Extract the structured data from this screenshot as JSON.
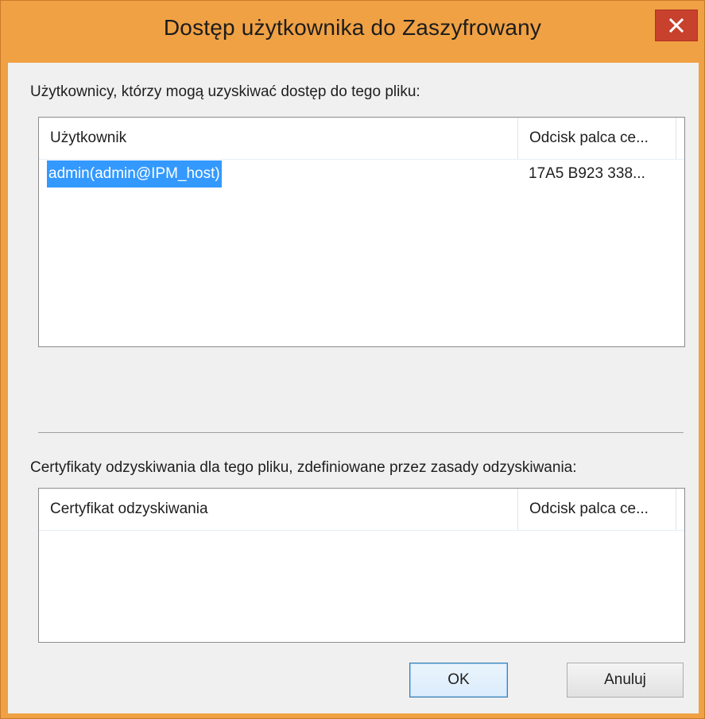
{
  "window": {
    "title": "Dostęp użytkownika do Zaszyfrowany",
    "close_glyph": "×"
  },
  "users_section": {
    "label": "Użytkownicy, którzy mogą uzyskiwać dostęp do tego pliku:",
    "columns": [
      "Użytkownik",
      "Odcisk palca ce..."
    ],
    "rows": [
      {
        "user": "admin(admin@IPM_host)",
        "thumbprint": "17A5 B923 338...",
        "selected": true
      }
    ]
  },
  "recovery_section": {
    "label": "Certyfikaty odzyskiwania dla tego pliku, zdefiniowane przez zasady odzyskiwania:",
    "columns": [
      "Certyfikat odzyskiwania",
      "Odcisk palca ce..."
    ],
    "rows": []
  },
  "buttons": {
    "ok": "OK",
    "cancel": "Anuluj"
  },
  "colors": {
    "frame": "#f0a144",
    "close_button": "#c7412d",
    "selection": "#3399ff",
    "client_bg": "#f0f0f0"
  }
}
